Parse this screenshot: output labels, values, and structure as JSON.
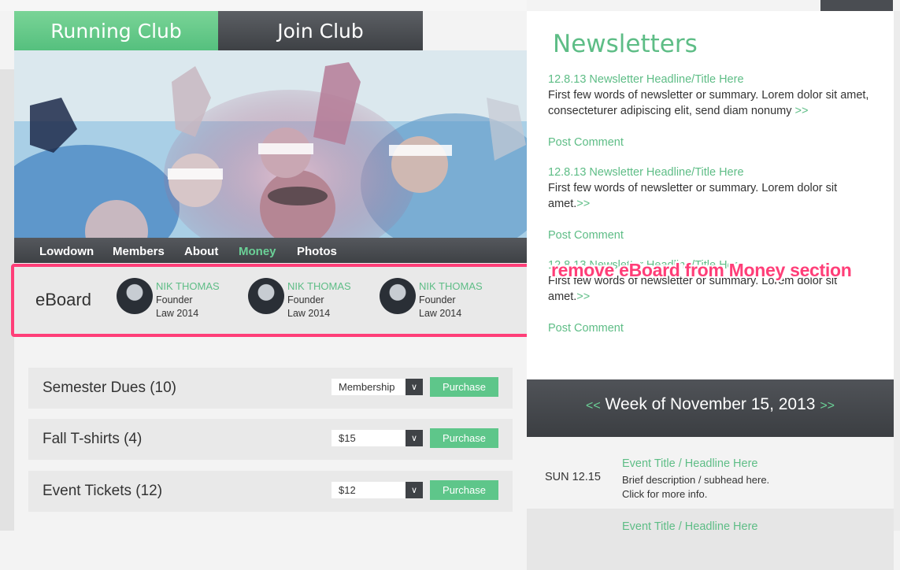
{
  "header": {
    "club_tab": "Running Club",
    "join_tab": "Join Club"
  },
  "nav": {
    "items": [
      "Lowdown",
      "Members",
      "About",
      "Money",
      "Photos"
    ],
    "active": "Money"
  },
  "eboard": {
    "title": "eBoard",
    "members": [
      {
        "name": "NIK THOMAS",
        "role": "Founder",
        "year": "Law 2014"
      },
      {
        "name": "NIK THOMAS",
        "role": "Founder",
        "year": "Law 2014"
      },
      {
        "name": "NIK THOMAS",
        "role": "Founder",
        "year": "Law 2014"
      }
    ]
  },
  "annotation": "remove eBoard from Money section",
  "purchases": [
    {
      "label": "Semester Dues (10)",
      "select": "Membership",
      "button": "Purchase"
    },
    {
      "label": "Fall T-shirts (4)",
      "select": "$15",
      "button": "Purchase"
    },
    {
      "label": "Event Tickets (12)",
      "select": "$12",
      "button": "Purchase"
    }
  ],
  "newsletters": {
    "title": "Newsletters",
    "items": [
      {
        "headline": "12.8.13 Newsletter Headline/Title Here",
        "summary": "First few words of newsletter or summary. Lorem dolor sit amet, consecteturer adipiscing elit, send diam nonumy",
        "more": ">>",
        "comment": "Post Comment"
      },
      {
        "headline": "12.8.13 Newsletter Headline/Title Here",
        "summary": "First few words of newsletter or summary. Lorem dolor sit amet.",
        "more": ">>",
        "comment": "Post Comment"
      },
      {
        "headline": "12.8.13 Newsletter Headline/Title Here",
        "summary": "First few words of newsletter or summary. Lorem dolor sit amet.",
        "more": ">>",
        "comment": "Post Comment"
      }
    ]
  },
  "week": {
    "prev": "<<",
    "label": "Week of November 15, 2013",
    "next": ">>"
  },
  "events": [
    {
      "date": "SUN 12.15",
      "title": "Event Title / Headline Here",
      "desc1": "Brief description / subhead here.",
      "desc2": "Click for more info."
    },
    {
      "date": "",
      "title": "Event Title / Headline Here",
      "desc1": "",
      "desc2": ""
    }
  ],
  "colors": {
    "accent": "#5ebd86",
    "dark": "#3e4145",
    "annotation": "#ff3e78"
  }
}
